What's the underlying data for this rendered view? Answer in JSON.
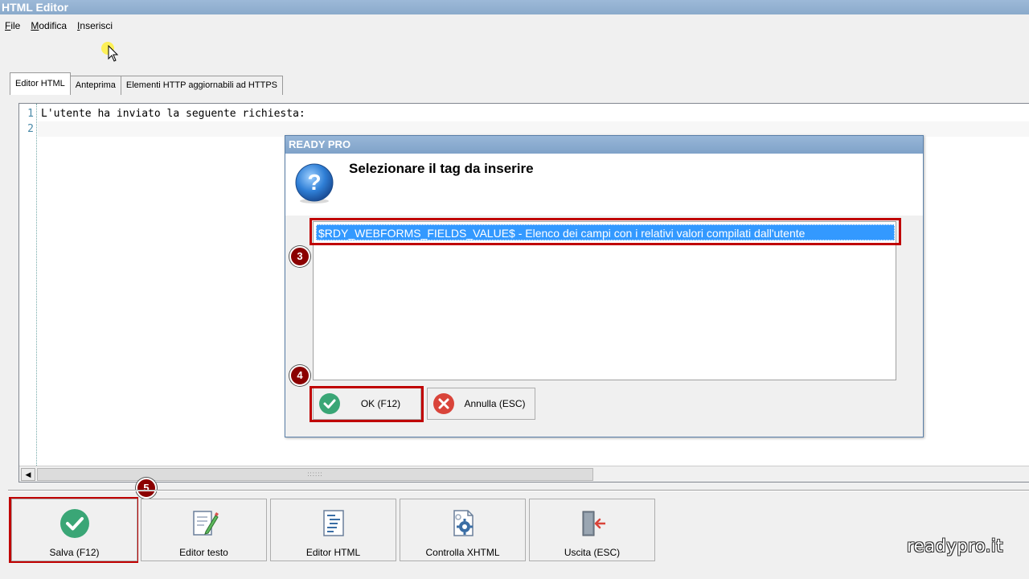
{
  "window": {
    "title": "HTML Editor"
  },
  "menu": {
    "items": [
      "File",
      "Modifica",
      "Inserisci"
    ]
  },
  "tabs": [
    "Editor HTML",
    "Anteprima",
    "Elementi HTTP aggiornabili ad HTTPS"
  ],
  "editor": {
    "line_numbers": [
      "1",
      "2"
    ],
    "lines": [
      "L'utente ha inviato la seguente richiesta:",
      ""
    ],
    "scroll_grip": "::::::"
  },
  "dialog": {
    "title": "READY PRO",
    "heading": "Selezionare il tag da inserire",
    "items": [
      "$RDY_WEBFORMS_FIELDS_VALUE$ - Elenco dei campi con i relativi valori compilati dall'utente"
    ],
    "ok_label": "OK (F12)",
    "cancel_label": "Annulla (ESC)"
  },
  "badges": {
    "step3": "3",
    "step4": "4",
    "step5": "5"
  },
  "toolbar": {
    "save": "Salva (F12)",
    "text_editor": "Editor testo",
    "html_editor": "Editor HTML",
    "check_xhtml": "Controlla XHTML",
    "exit": "Uscita (ESC)"
  },
  "watermark": "readypro.it",
  "colors": {
    "highlight_red": "#c00000",
    "selection_blue": "#3399ff",
    "badge_red": "#8b0000",
    "ok_green": "#3aa676",
    "cancel_red": "#d9443a"
  }
}
